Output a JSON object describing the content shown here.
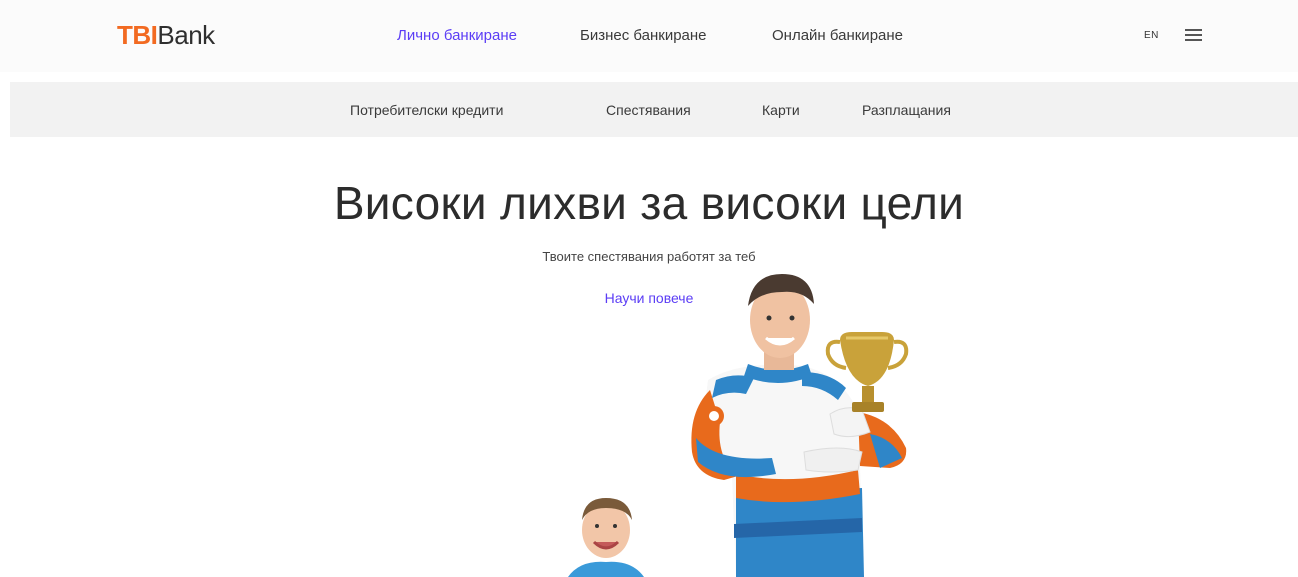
{
  "header": {
    "logo": {
      "part1": "TBI",
      "part2": "Bank"
    },
    "nav": [
      {
        "label": "Лично банкиране",
        "active": true
      },
      {
        "label": "Бизнес банкиране",
        "active": false
      },
      {
        "label": "Онлайн банкиране",
        "active": false
      }
    ],
    "language": "EN",
    "menu_icon": "hamburger-menu-icon"
  },
  "subnav": {
    "items": [
      {
        "label": "Потребителски кредити"
      },
      {
        "label": "Спестявания"
      },
      {
        "label": "Карти"
      },
      {
        "label": "Разплащания"
      }
    ]
  },
  "hero": {
    "title": "Високи лихви за високи цели",
    "subtitle": "Твоите спестявания работят за теб",
    "cta": "Научи повече"
  },
  "colors": {
    "brand_orange": "#f26a21",
    "accent_purple": "#5b3df5",
    "subnav_bg": "#f2f2f2"
  }
}
